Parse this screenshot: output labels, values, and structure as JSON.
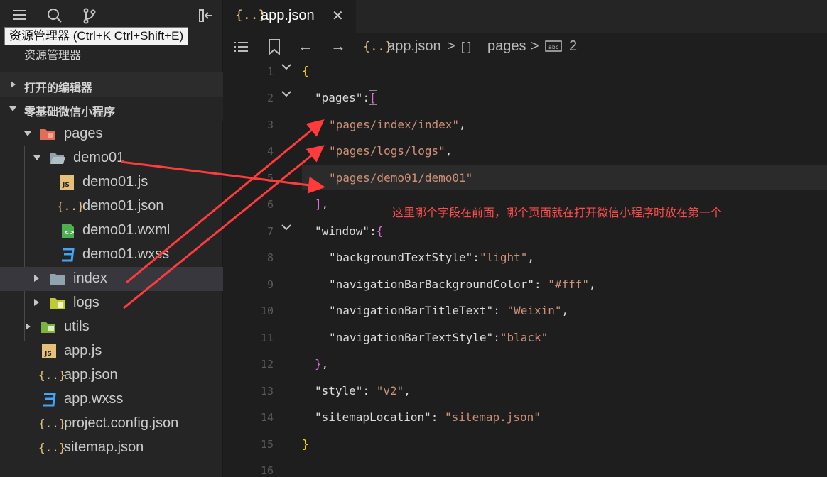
{
  "sidebar": {
    "toolbar_icons": [
      "list-icon",
      "search-icon",
      "source-control-icon",
      "collapse-panel-icon"
    ],
    "tooltip": "资源管理器 (Ctrl+K Ctrl+Shift+E)",
    "heading": "资源管理器",
    "sections": [
      {
        "label": "打开的编辑器",
        "expanded": false
      },
      {
        "label": "零基础微信小程序",
        "expanded": true
      }
    ],
    "tree": [
      {
        "label": "pages",
        "type": "folder-pages",
        "expanded": true
      },
      {
        "label": "demo01",
        "type": "folder",
        "expanded": true
      },
      {
        "label": "demo01.js",
        "type": "js"
      },
      {
        "label": "demo01.json",
        "type": "json"
      },
      {
        "label": "demo01.wxml",
        "type": "wxml"
      },
      {
        "label": "demo01.wxss",
        "type": "wxss"
      },
      {
        "label": "index",
        "type": "folder",
        "expanded": false
      },
      {
        "label": "logs",
        "type": "folder-logs",
        "expanded": false
      },
      {
        "label": "utils",
        "type": "folder-utils",
        "expanded": false
      },
      {
        "label": "app.js",
        "type": "js"
      },
      {
        "label": "app.json",
        "type": "json"
      },
      {
        "label": "app.wxss",
        "type": "wxss"
      },
      {
        "label": "project.config.json",
        "type": "json"
      },
      {
        "label": "sitemap.json",
        "type": "json"
      }
    ]
  },
  "editor": {
    "tab": {
      "icon": "{..}",
      "label": "app.json",
      "close": "✕"
    },
    "breadcrumb": {
      "file_icon": "{..}",
      "file": "app.json",
      "sep": ">",
      "array_icon": "[ ]",
      "key": "pages",
      "index": "2"
    },
    "lines": [
      {
        "n": "1",
        "fold": true
      },
      {
        "n": "2",
        "fold": true
      },
      {
        "n": "3"
      },
      {
        "n": "4"
      },
      {
        "n": "5"
      },
      {
        "n": "6"
      },
      {
        "n": "7",
        "fold": true
      },
      {
        "n": "8"
      },
      {
        "n": "9"
      },
      {
        "n": "10"
      },
      {
        "n": "11"
      },
      {
        "n": "12"
      },
      {
        "n": "13"
      },
      {
        "n": "14"
      },
      {
        "n": "15"
      },
      {
        "n": "16"
      }
    ],
    "code": {
      "l1": "{",
      "l2_key": "\"pages\"",
      "l3": "\"pages/index/index\"",
      "l4": "\"pages/logs/logs\"",
      "l5": "\"pages/demo01/demo01\"",
      "l7_key": "\"window\"",
      "l8_key": "\"backgroundTextStyle\"",
      "l8_val": "\"light\"",
      "l9_key": "\"navigationBarBackgroundColor\"",
      "l9_val": "\"#fff\"",
      "l10_key": "\"navigationBarTitleText\"",
      "l10_val": "\"Weixin\"",
      "l11_key": "\"navigationBarTextStyle\"",
      "l11_val": "\"black\"",
      "l13_key": "\"style\"",
      "l13_val": "\"v2\"",
      "l14_key": "\"sitemapLocation\"",
      "l14_val": "\"sitemap.json\""
    }
  },
  "annotation": "这里哪个字段在前面，哪个页面就在打开微信小程序时放在第一个",
  "colors": {
    "annotation": "#ff4c4c",
    "json_icon": "#e5c07b",
    "string": "#ce9178",
    "bracket": "#ffd700"
  }
}
